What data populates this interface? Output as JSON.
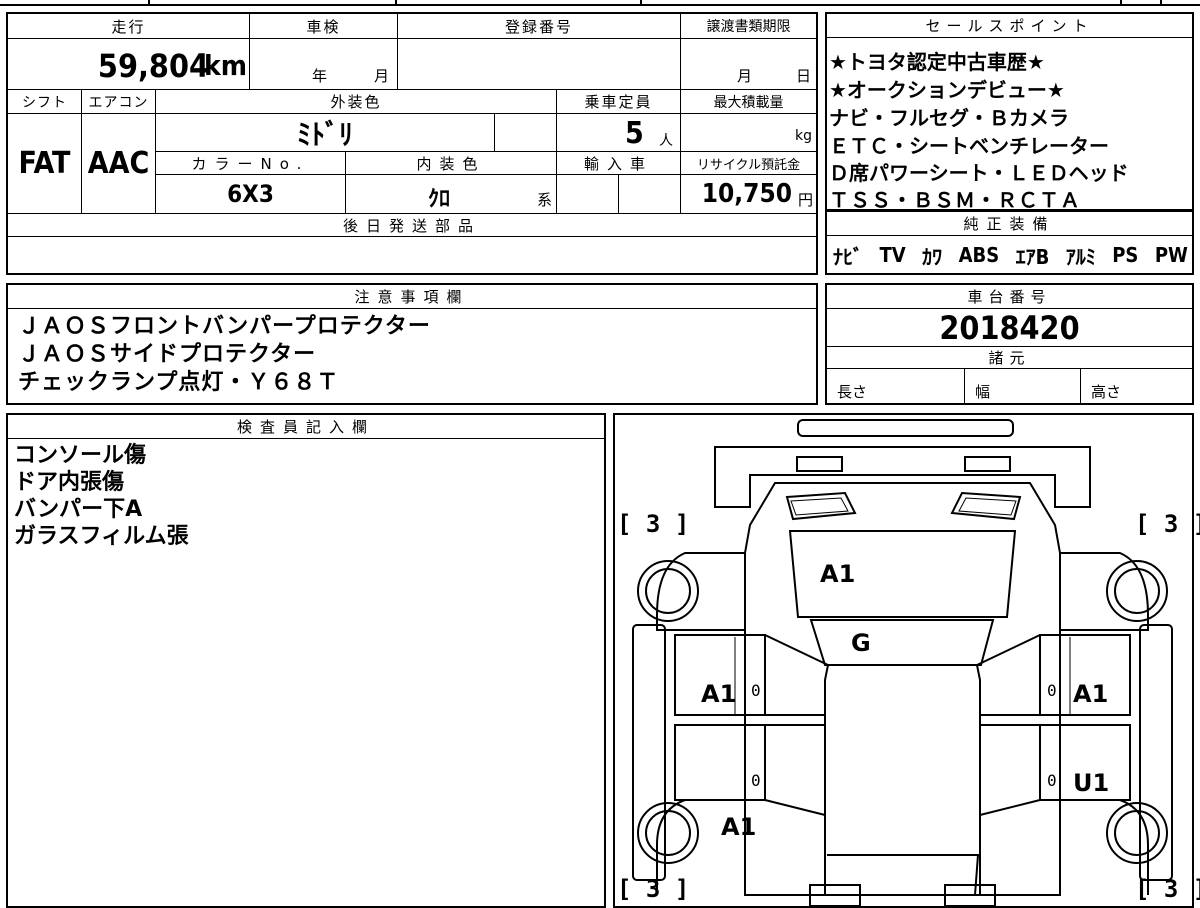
{
  "header": {
    "mileage_label": "走行",
    "mileage_value": "59,804",
    "mileage_unit": "km",
    "inspection_label": "車検",
    "inspection_year_unit": "年",
    "inspection_month_unit": "月",
    "registration_label": "登録番号",
    "registration_value": "",
    "transfer_label": "譲渡書類期限",
    "transfer_month_unit": "月",
    "transfer_day_unit": "日"
  },
  "specs": {
    "shift_label": "シフト",
    "shift_value": "FAT",
    "aircon_label": "エアコン",
    "aircon_value": "AAC",
    "exterior_label": "外装色",
    "exterior_value": "ﾐﾄﾞﾘ",
    "capacity_label": "乗車定員",
    "capacity_value": "5",
    "capacity_unit": "人",
    "maxload_label": "最大積載量",
    "maxload_unit": "kg",
    "color_no_label": "カラーNo.",
    "color_no_value": "6X3",
    "interior_label": "内装色",
    "interior_value": "ｸﾛ",
    "interior_unit": "系",
    "import_label": "輸入車",
    "recycle_label": "リサイクル預託金",
    "recycle_value": "10,750",
    "recycle_unit": "円",
    "later_parts_label": "後日発送部品"
  },
  "sales_points": {
    "title": "セールスポイント",
    "lines": [
      "★トヨタ認定中古車歴★",
      "★オークションデビュー★",
      "ナビ・フルセグ・Ｂカメラ",
      "ＥＴＣ・シートベンチレーター",
      "Ｄ席パワーシート・ＬＥＤヘッド",
      "ＴＳＳ・ＢＳＭ・ＲＣＴＡ"
    ]
  },
  "equipment": {
    "title": "純正装備",
    "items": [
      "ﾅﾋﾞ",
      "TV",
      "ｶﾜ",
      "ABS",
      "ｴｱB",
      "ｱﾙﾐ",
      "PS",
      "PW"
    ]
  },
  "notes": {
    "title": "注意事項欄",
    "lines": [
      "ＪＡＯＳフロントバンパープロテクター",
      "ＪＡＯＳサイドプロテクター",
      "チェックランプ点灯・Ｙ６８Ｔ"
    ]
  },
  "chassis": {
    "title": "車台番号",
    "value": "2018420",
    "specs_title": "諸元",
    "length_label": "長さ",
    "width_label": "幅",
    "height_label": "高さ"
  },
  "inspector": {
    "title": "検査員記入欄",
    "lines": [
      "コンソール傷",
      "ドア内張傷",
      "バンパー下A",
      "ガラスフィルム張"
    ]
  },
  "diagram": {
    "tire_front_left": "3",
    "tire_front_right": "3",
    "tire_rear_left": "3",
    "tire_rear_right": "3",
    "bracket_open": "[",
    "bracket_close": "]",
    "hood": "A1",
    "windshield": "G",
    "left_front_door": "A1",
    "right_front_door": "A1",
    "right_rear_door": "U1",
    "left_rear_fender": "A1",
    "lf_zero": "0",
    "rf_zero": "0",
    "lr_zero": "0",
    "rr_zero": "0"
  }
}
